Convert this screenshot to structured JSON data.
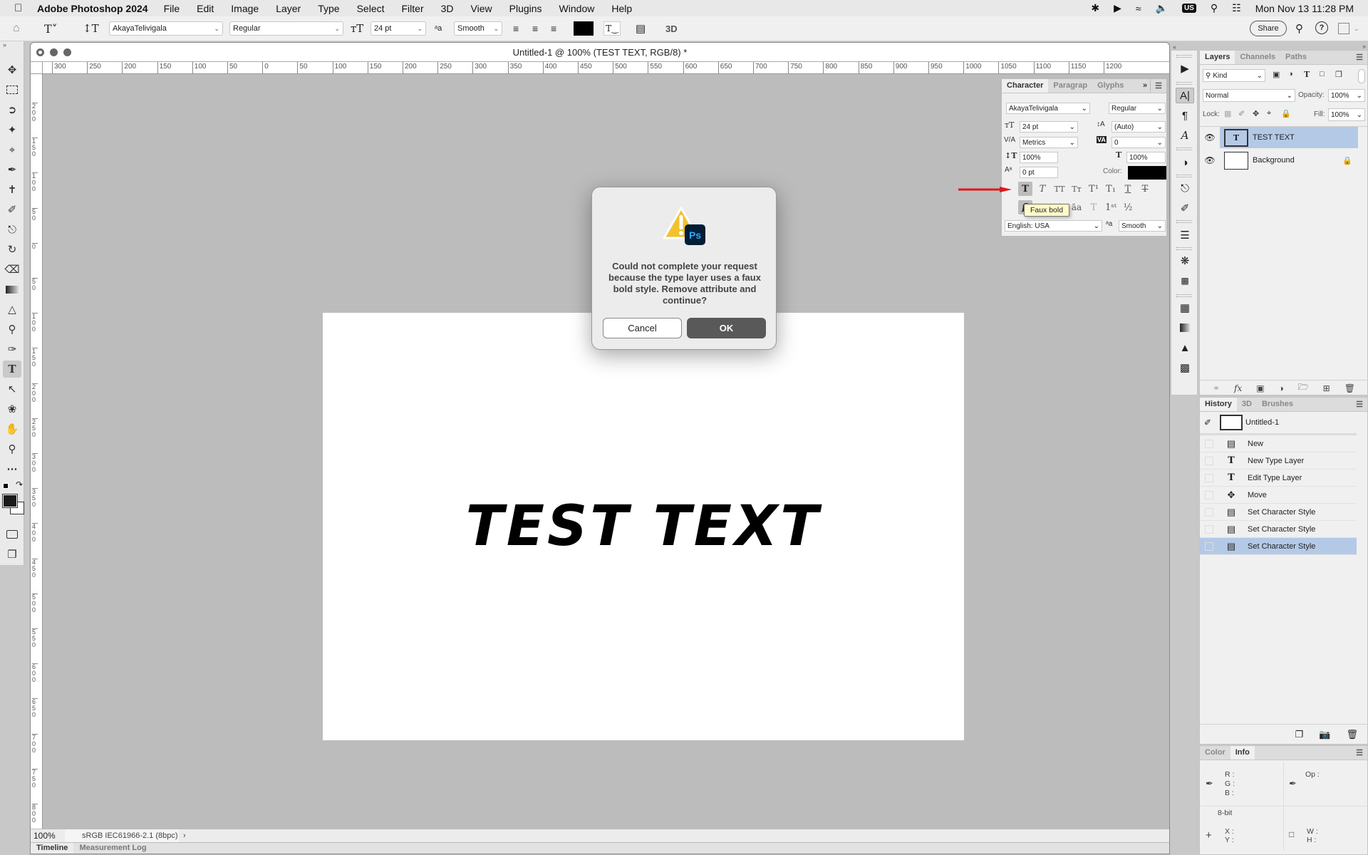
{
  "menubar": {
    "app_name": "Adobe Photoshop 2024",
    "items": [
      "File",
      "Edit",
      "Image",
      "Layer",
      "Type",
      "Select",
      "Filter",
      "3D",
      "View",
      "Plugins",
      "Window",
      "Help"
    ],
    "keyboard_layout": "US",
    "datetime": "Mon Nov 13  11:28 PM"
  },
  "options_bar": {
    "font_family": "AkayaTelivigala",
    "font_style": "Regular",
    "font_size": "24 pt",
    "anti_alias": "Smooth",
    "text_color": "#000000",
    "share_label": "Share",
    "threed_label": "3D"
  },
  "document": {
    "title": "Untitled-1 @ 100% (TEST TEXT, RGB/8) *",
    "canvas_text": "TEST TEXT",
    "zoom": "100%",
    "color_profile": "sRGB IEC61966-2.1 (8bpc)",
    "h_ruler_labels": [
      "300",
      "250",
      "200",
      "150",
      "100",
      "50",
      "0",
      "50",
      "100",
      "150",
      "200",
      "250",
      "300",
      "350",
      "400",
      "450",
      "500",
      "550",
      "600",
      "650",
      "700",
      "750",
      "800",
      "850",
      "900",
      "950",
      "1000",
      "1050",
      "1100",
      "1150",
      "1200"
    ],
    "v_ruler_labels": [
      "200",
      "150",
      "100",
      "50",
      "0",
      "50",
      "100",
      "150",
      "200",
      "250",
      "300",
      "350",
      "400",
      "450",
      "500",
      "550",
      "600",
      "650",
      "700",
      "750",
      "800"
    ]
  },
  "bottom_tabs": [
    "Timeline",
    "Measurement Log"
  ],
  "character_panel": {
    "tabs": [
      "Character",
      "Paragrap",
      "Glyphs"
    ],
    "font_family": "AkayaTelivigala",
    "font_style": "Regular",
    "size": "24 pt",
    "leading": "(Auto)",
    "kerning": "Metrics",
    "tracking": "0",
    "vertical_scale": "100%",
    "horizontal_scale": "100%",
    "baseline_shift": "0 pt",
    "color_label": "Color:",
    "color": "#000000",
    "language": "English: USA",
    "anti_alias": "Smooth",
    "tooltip": "Faux bold"
  },
  "layers_panel": {
    "tabs": [
      "Layers",
      "Channels",
      "Paths"
    ],
    "filter": "Kind",
    "blend_mode": "Normal",
    "opacity_label": "Opacity:",
    "opacity": "100%",
    "lock_label": "Lock:",
    "fill_label": "Fill:",
    "fill": "100%",
    "layers": [
      {
        "name": "TEST TEXT",
        "type": "text",
        "selected": true
      },
      {
        "name": "Background",
        "type": "image",
        "locked": true
      }
    ]
  },
  "history_panel": {
    "tabs": [
      "History",
      "3D",
      "Brushes"
    ],
    "snapshot": "Untitled-1",
    "items": [
      "New",
      "New Type Layer",
      "Edit Type Layer",
      "Move",
      "Set Character Style",
      "Set Character Style",
      "Set Character Style"
    ],
    "selected_index": 6
  },
  "info_panel": {
    "tabs": [
      "Color",
      "Info"
    ],
    "r": "R :",
    "g": "G :",
    "b": "B :",
    "op": "Op :",
    "bit_depth": "8-bit",
    "x": "X :",
    "y": "Y :",
    "w": "W :",
    "h": "H :"
  },
  "dialog": {
    "message": "Could not complete your request because the type layer uses a faux bold style.  Remove attribute and continue?",
    "cancel_label": "Cancel",
    "ok_label": "OK",
    "badge": "Ps"
  },
  "colors": {
    "selection": "#b4c9e6",
    "annotation_arrow": "#e01818",
    "ps_badge": "#001e36",
    "ps_badge_text": "#31a8ff"
  }
}
